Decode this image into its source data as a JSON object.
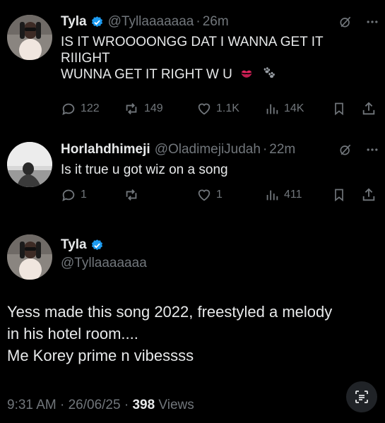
{
  "thread": [
    {
      "author_name": "Tyla",
      "handle": "@Tyllaaaaaaa",
      "time": "26m",
      "text_lines": [
        "IS IT WROOOONGG DAT I WANNA GET IT",
        "RIIIGHT",
        "WUNNA GET IT RIGHT W U"
      ],
      "emoji": [
        "kiss-mark-emoji",
        "paw-prints-emoji"
      ],
      "replies": "122",
      "reposts": "149",
      "likes": "1.1K",
      "views": "14K"
    },
    {
      "author_name": "Horlahdhimeji",
      "handle": "@OladimejiJudah",
      "time": "22m",
      "text": "Is it true u got wiz on a song",
      "replies": "1",
      "reposts": "",
      "likes": "1",
      "views": "411"
    }
  ],
  "main_post": {
    "author_name": "Tyla",
    "handle": "@Tyllaaaaaaa",
    "text_lines": [
      "Yess made this song 2022, freestyled a melody",
      "in his hotel room....",
      "Me Korey prime n vibessss"
    ],
    "timestamp": "9:31 AM · 26/06/25 · ",
    "views_count": "398",
    "views_label": " Views"
  },
  "separator": "·",
  "colors": {
    "background": "#000000",
    "text": "#e7e9ea",
    "muted": "#71767b",
    "verified": "#1d9bf0"
  }
}
